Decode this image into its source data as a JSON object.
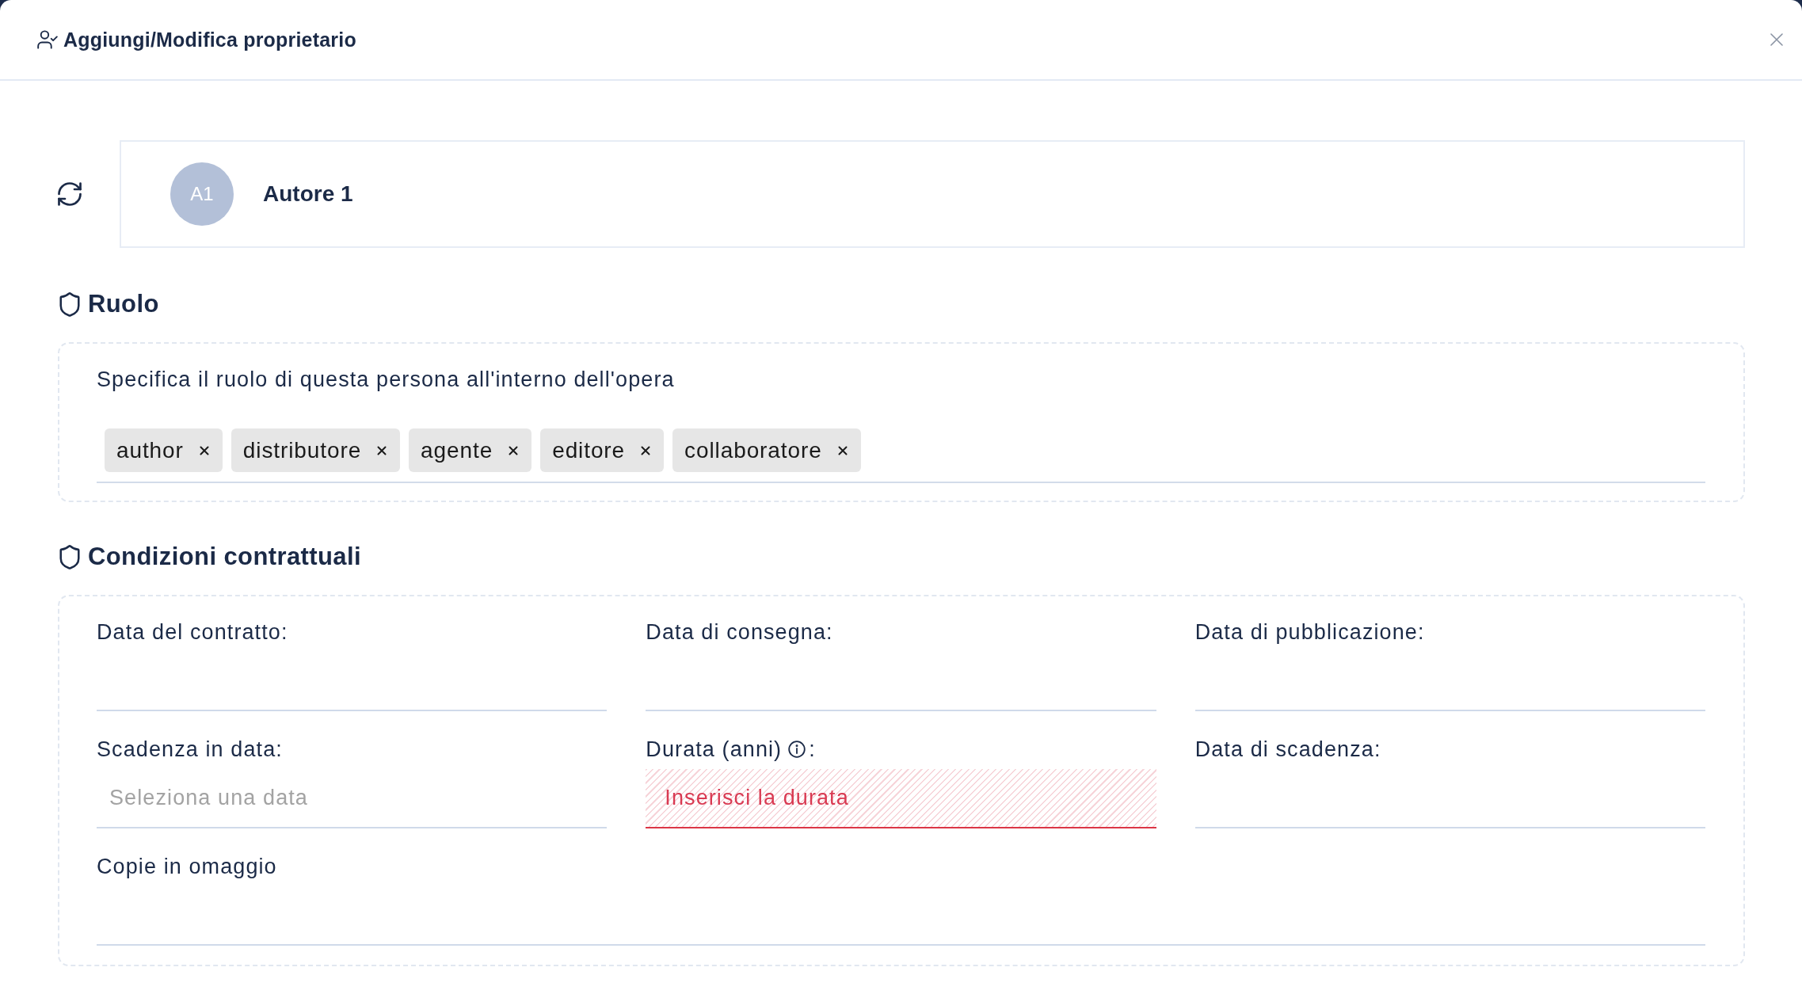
{
  "dialog": {
    "title": "Aggiungi/Modifica proprietario"
  },
  "owner": {
    "initials": "A1",
    "name": "Autore 1"
  },
  "role_section": {
    "heading": "Ruolo",
    "description": "Specifica il ruolo di questa persona all'interno dell'opera",
    "tags": [
      "author",
      "distributore",
      "agente",
      "editore",
      "collaboratore"
    ]
  },
  "contract_section": {
    "heading": "Condizioni contrattuali",
    "fields": [
      {
        "label": "Data del contratto:",
        "info": false,
        "error": false,
        "full_width": false
      },
      {
        "label": "Data di consegna:",
        "info": false,
        "error": false,
        "full_width": false
      },
      {
        "label": "Data di pubblicazione:",
        "info": false,
        "error": false,
        "full_width": false
      },
      {
        "label": "Scadenza in data:",
        "placeholder": "Seleziona una data",
        "info": false,
        "error": false,
        "full_width": false
      },
      {
        "label": "Durata (anni)",
        "label_suffix": ":",
        "placeholder": "Inserisci la durata",
        "info": true,
        "error": true,
        "full_width": false
      },
      {
        "label": "Data di scadenza:",
        "info": false,
        "error": false,
        "full_width": false
      },
      {
        "label": "Copie in omaggio",
        "info": false,
        "error": false,
        "full_width": true
      }
    ]
  }
}
